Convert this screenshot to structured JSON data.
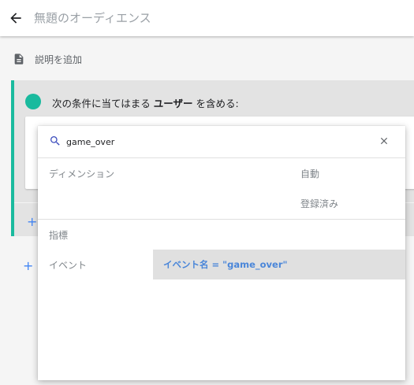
{
  "header": {
    "title": "無題のオーディエンス",
    "back_icon": "arrow-back-icon"
  },
  "description": {
    "label": "説明を追加",
    "icon": "document-icon"
  },
  "condition": {
    "text_prefix": "次の条件に当てはまる ",
    "text_bold": "ユーザー",
    "text_suffix": " を含める:",
    "accent_color": "#1aba9e",
    "add_icon": "+"
  },
  "outer_add_icon": "+",
  "dropdown": {
    "search": {
      "value": "game_over",
      "icon": "search-icon",
      "close_icon": "close-icon"
    },
    "categories": {
      "dimension": {
        "label": "ディメンション",
        "items": [
          "自動",
          "登録済み"
        ]
      },
      "metric": {
        "label": "指標"
      },
      "event": {
        "label": "イベント",
        "result": "イベント名 = \"game_over\""
      }
    },
    "highlight_color": "#e0e0e0",
    "result_text_color": "#4a86d9"
  }
}
